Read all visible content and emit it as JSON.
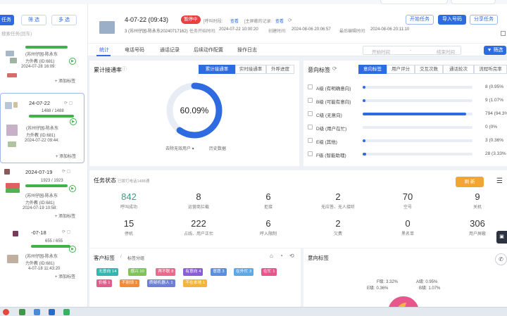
{
  "filters": {
    "task_button": "任务",
    "filter_button": "筛 选",
    "multi_button": "多 选",
    "search_placeholder": "搜索任务(回车)"
  },
  "cards": [
    {
      "title": "",
      "line1": "(苏州仔园-陈永东",
      "line2": "力外教 (ID:681)",
      "date": "2024-07-28 16:09:",
      "add": "+ 添加标签",
      "count": "",
      "progress": 1
    },
    {
      "title": "24-07-22",
      "count": "1488 / 1488",
      "line1": "(苏州仔园-陈永东",
      "line2": "力外教 (ID:681)",
      "date": "2024-07-22 09:44:",
      "add": "+ 添加标签",
      "progress": 1
    },
    {
      "title": "2024-07-19",
      "count": "1923 / 1923",
      "line1": "(苏州仔园-陈永东",
      "line2": "力外教 (ID:681)",
      "date": "2024-07-19 10:58:",
      "add": "+ 添加标签",
      "progress": 1
    },
    {
      "title": "-07-18",
      "count": "655 / 655",
      "line1": "(苏州仔园-陈永东",
      "line2": "力外教 (ID:681)",
      "date": "4-07-18 11:43:20",
      "add": "+ 添加标签",
      "progress": 1
    }
  ],
  "header": {
    "title": "4-07-22 (09:43)",
    "status": "暂停中",
    "meta1_label": "[呼叫时段:",
    "meta1_link": "查看",
    "meta2_label": "[主屏蔽的记录:",
    "meta2_link": "查看",
    "sub1": "3 (苏州仔园-陈永东20240717162)",
    "start_label": "任务开始时间:",
    "start_time": "2024-07-22 10:00:20",
    "create_label": "创建时间:",
    "create_time": "2024-08-06 20:06:57",
    "finish_label": "最后编辑时间:",
    "finish_time": "2024-08-06 20:11:10",
    "btn_start": "开始任务",
    "btn_import": "导入号码",
    "btn_share": "分享任务"
  },
  "tabs": [
    "统计",
    "电话号码",
    "通话记录",
    "后续动作配置",
    "操作日志"
  ],
  "date_range": {
    "start": "开始时间",
    "sep": "-",
    "end": "结束时间",
    "filter": "筛选"
  },
  "rate": {
    "title": "累计接通率",
    "tabs": [
      "累计接通率",
      "实时接通率",
      "外呼进度"
    ],
    "value": "60.09%",
    "fraction": 0.6009,
    "legend1": "去除无效用户",
    "legend2": "历史数据"
  },
  "intent": {
    "title": "意向标签",
    "tabs": [
      "意向标签",
      "用户评分",
      "交互次数",
      "通话轮次",
      "流程听完率"
    ],
    "rows": [
      {
        "label": "A级 (有明确意向)",
        "value": "8",
        "pct": "(0.95%",
        "frac": 0.0095
      },
      {
        "label": "B级 (可能有意向)",
        "value": "9",
        "pct": "(1.07%",
        "frac": 0.0107
      },
      {
        "label": "C级 (无意向)",
        "value": "794",
        "pct": "(94.3%",
        "frac": 0.943
      },
      {
        "label": "D级 (用户在忙)",
        "value": "0",
        "pct": "(0%",
        "frac": 0
      },
      {
        "label": "E级 (其他)",
        "value": "3",
        "pct": "(0.36%",
        "frac": 0.0036
      },
      {
        "label": "F级 (智能助理)",
        "value": "28",
        "pct": "(3.33%",
        "frac": 0.0333
      }
    ]
  },
  "task_status": {
    "title": "任务状态",
    "subtitle": "已拨打电话1488通",
    "refresh": "刷 新",
    "stats": [
      {
        "n": "842",
        "l": "呼叫成功",
        "green": true
      },
      {
        "n": "8",
        "l": "运营商拦截"
      },
      {
        "n": "6",
        "l": "拒接"
      },
      {
        "n": "2",
        "l": "无应答、无人接听"
      },
      {
        "n": "70",
        "l": "空号"
      },
      {
        "n": "9",
        "l": "关机"
      },
      {
        "n": "15",
        "l": "停机"
      },
      {
        "n": "222",
        "l": "占线、用户正忙"
      },
      {
        "n": "6",
        "l": "呼入限制"
      },
      {
        "n": "2",
        "l": "欠费"
      },
      {
        "n": "0",
        "l": "黑名单"
      },
      {
        "n": "306",
        "l": "用户屏蔽"
      }
    ]
  },
  "customer_tags": {
    "title": "客户标签",
    "sub": "标签分组",
    "chips": [
      {
        "t": "无意向 14",
        "c": "#31b7b0"
      },
      {
        "t": "感兴 10",
        "c": "#7fc35a"
      },
      {
        "t": "再不联 8",
        "c": "#e96a8d"
      },
      {
        "t": "有意向 4",
        "c": "#8b5dd8"
      },
      {
        "t": "意愿 3",
        "c": "#5a8fe0"
      },
      {
        "t": "在外忙 3",
        "c": "#5fa8e8"
      },
      {
        "t": "在忙 1",
        "c": "#e7578b"
      },
      {
        "t": "价格 1",
        "c": "#e05e8c"
      },
      {
        "t": "不耐烦 1",
        "c": "#f08b3a"
      },
      {
        "t": "质疑机器人 1",
        "c": "#6d7fd6"
      },
      {
        "t": "不在本地 1",
        "c": "#f2b43a"
      }
    ]
  },
  "intent_pie": {
    "title": "意向标签",
    "labels": [
      "F级: 3.32%",
      "A级: 0.95%",
      "E级: 0.36%",
      "B级: 1.07%"
    ]
  }
}
